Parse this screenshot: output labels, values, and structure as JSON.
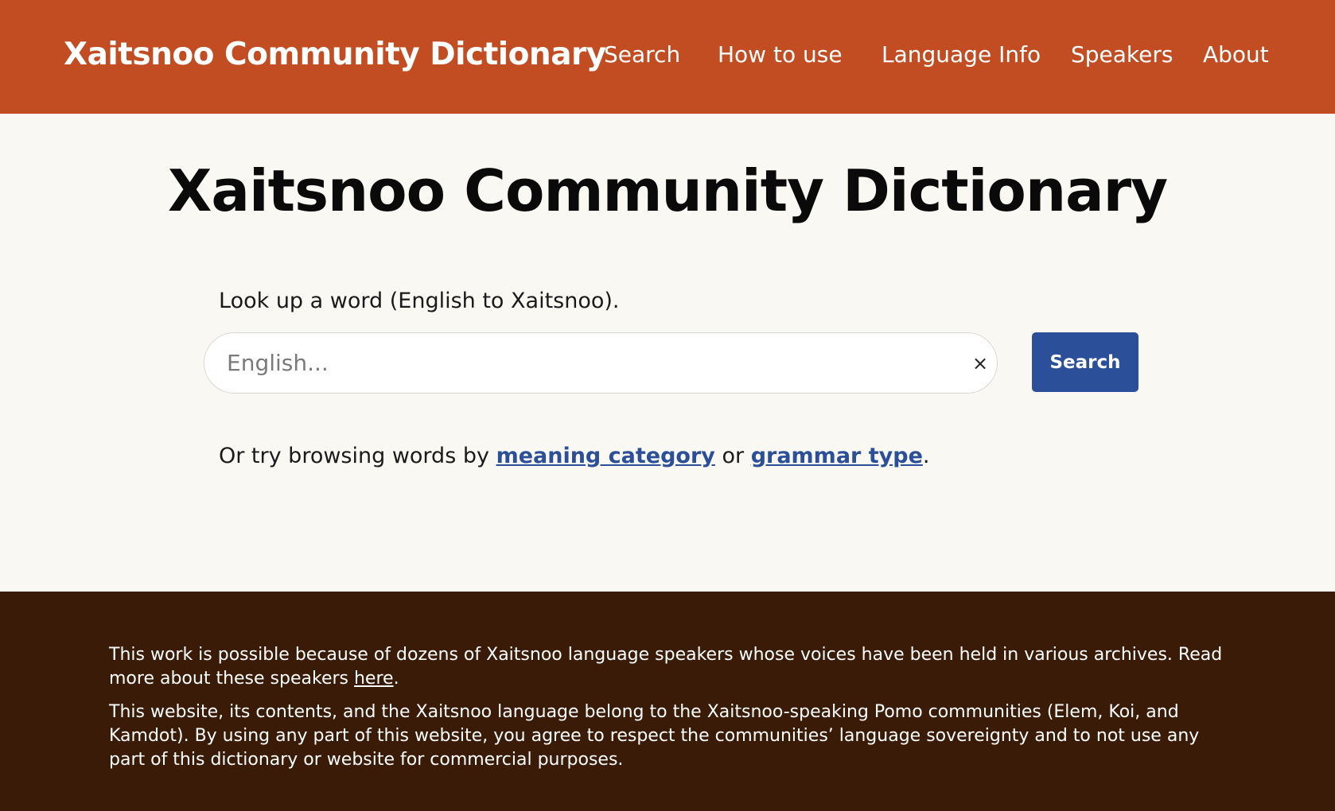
{
  "header": {
    "site_title": "Xaitsnoo Community Dictionary",
    "nav": [
      "Search",
      "How to use",
      "Language Info",
      "Speakers",
      "About"
    ]
  },
  "main": {
    "title": "Xaitsnoo Community Dictionary",
    "lookup_label": "Look up a word (English to Xaitsnoo).",
    "search_placeholder": "English...",
    "search_value": "",
    "clear_label": "×",
    "search_button_label": "Search",
    "browse": {
      "prefix": "Or try browsing words by ",
      "link1": "meaning category",
      "middle": " or ",
      "link2": "grammar type",
      "suffix": "."
    }
  },
  "footer": {
    "p1_text": "This work is possible because of dozens of Xaitsnoo language speakers whose voices have been held in various archives. Read more about these speakers ",
    "p1_link": "here",
    "p1_end": ".",
    "p2_text": "This website, its contents, and the Xaitsnoo language belong to the Xaitsnoo-speaking Pomo communities (Elem, Koi, and Kamdot). By using any part of this website, you agree to respect the communities’ language sovereignty and to not use any part of this dictionary or website for commercial purposes."
  },
  "colors": {
    "header_bg": "#c24d22",
    "footer_bg": "#3a1b08",
    "accent_blue": "#2b4f99",
    "page_bg": "#faf8f3"
  }
}
